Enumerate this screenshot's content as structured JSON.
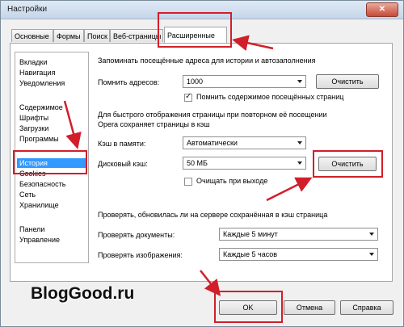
{
  "window": {
    "title": "Настройки",
    "close_glyph": "✕"
  },
  "tabs": [
    "Основные",
    "Формы",
    "Поиск",
    "Веб-страницы",
    "Расширенные"
  ],
  "categories": [
    "Вкладки",
    "Навигация",
    "Уведомления",
    "Содержимое",
    "Шрифты",
    "Загрузки",
    "Программы",
    "История",
    "Cookies",
    "Безопасность",
    "Сеть",
    "Хранилище",
    "Панели",
    "Управление"
  ],
  "selected_category": "История",
  "history": {
    "section_label": "Запоминать посещённые адреса для истории и автозаполнения",
    "remember_label": "Помнить адресов:",
    "remember_value": "1000",
    "clear_button": "Очистить",
    "remember_content_label": "Помнить содержимое посещённых страниц",
    "remember_content_checked": true
  },
  "cache": {
    "desc_line1": "Для быстрого отображения страницы при повторном её посещении",
    "desc_line2": "Opera сохраняет страницы в кэш",
    "memory_label": "Кэш в памяти:",
    "memory_value": "Автоматически",
    "disk_label": "Дисковый кэш:",
    "disk_value": "50 МБ",
    "clear_button": "Очистить",
    "clear_on_exit_label": "Очищать при выходе",
    "clear_on_exit_checked": false
  },
  "check": {
    "section_label": "Проверять, обновилась ли на сервере сохранённая в кэш страница",
    "docs_label": "Проверять документы:",
    "docs_value": "Каждые 5 минут",
    "images_label": "Проверять изображения:",
    "images_value": "Каждые 5 часов"
  },
  "footer": {
    "ok": "OK",
    "cancel": "Отмена",
    "help": "Справка"
  },
  "watermark": "BlogGood.ru",
  "colors": {
    "highlight": "#d11f2a",
    "selection": "#3399ff"
  }
}
